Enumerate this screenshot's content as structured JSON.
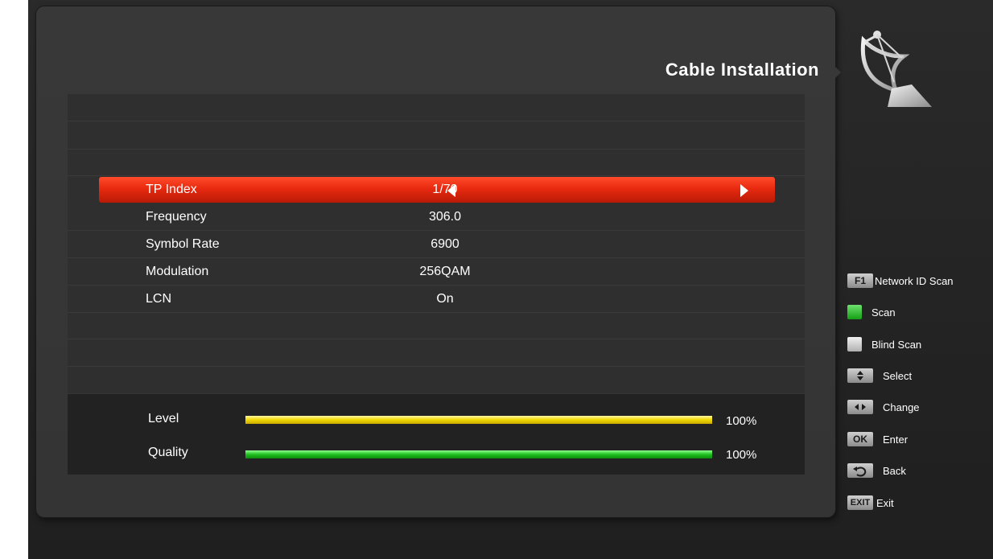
{
  "title": "Cable Installation",
  "params": [
    {
      "label": "TP Index",
      "value": "1/70"
    },
    {
      "label": "Frequency",
      "value": "306.0"
    },
    {
      "label": "Symbol Rate",
      "value": "6900"
    },
    {
      "label": "Modulation",
      "value": "256QAM"
    },
    {
      "label": "LCN",
      "value": "On"
    }
  ],
  "signal": {
    "level": {
      "label": "Level",
      "value": "100%",
      "percent": 100
    },
    "quality": {
      "label": "Quality",
      "value": "100%",
      "percent": 100
    }
  },
  "help": [
    {
      "key": "F1",
      "label": "Network ID Scan"
    },
    {
      "key": "",
      "label": "Scan",
      "color": "#22c422"
    },
    {
      "key": "",
      "label": "Blind Scan",
      "color": "#d8d8d8"
    },
    {
      "key": "up-down",
      "label": "Select"
    },
    {
      "key": "left-right",
      "label": "Change"
    },
    {
      "key": "OK",
      "label": "Enter"
    },
    {
      "key": "back",
      "label": "Back"
    },
    {
      "key": "EXIT",
      "label": "Exit"
    }
  ],
  "colors": {
    "highlight": "#e82a10",
    "level_bar": "#f0d800",
    "quality_bar": "#20c020"
  }
}
